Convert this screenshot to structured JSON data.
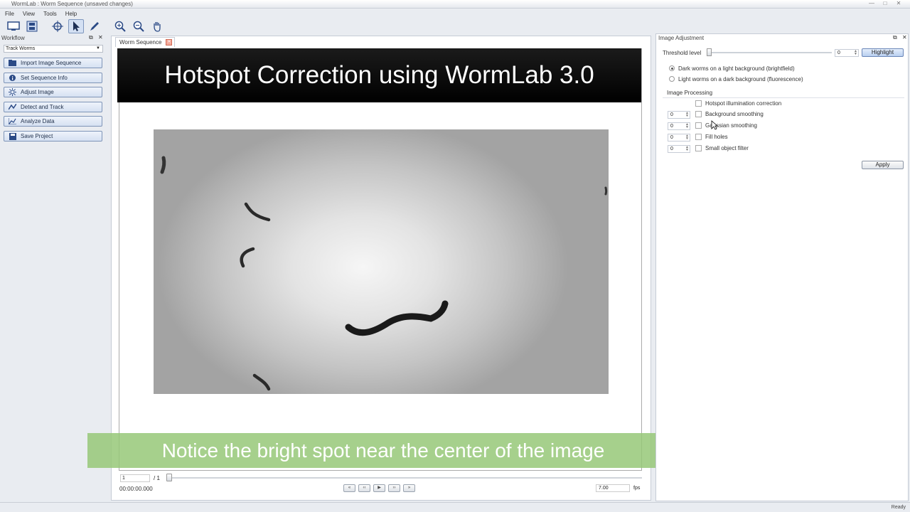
{
  "window": {
    "title": "WormLab : Worm Sequence (unsaved changes)"
  },
  "menu": [
    "File",
    "View",
    "Tools",
    "Help"
  ],
  "toolbar": {
    "icons": [
      "monitor-icon",
      "film-icon",
      "crosshair-icon",
      "pointer-icon",
      "pen-icon",
      "zoom-in-icon",
      "zoom-out-icon",
      "hand-icon"
    ],
    "active": "pointer-icon"
  },
  "workflow": {
    "title": "Workflow",
    "mode": "Track Worms",
    "steps": [
      {
        "label": "Import Image Sequence",
        "icon": "folder-icon"
      },
      {
        "label": "Set Sequence Info",
        "icon": "info-icon"
      },
      {
        "label": "Adjust Image",
        "icon": "sun-icon"
      },
      {
        "label": "Detect and Track",
        "icon": "track-icon"
      },
      {
        "label": "Analyze Data",
        "icon": "chart-icon"
      },
      {
        "label": "Save Project",
        "icon": "save-icon"
      }
    ]
  },
  "document": {
    "tab": "Worm Sequence",
    "banner": "Hotspot Correction using WormLab 3.0",
    "caption": "Notice the bright spot near the center of the image"
  },
  "playback": {
    "frame": "1",
    "total": "/ 1",
    "time": "00:00:00.000",
    "fps": "7.00",
    "fps_label": "fps",
    "buttons": [
      "«",
      "‹‹",
      "▶",
      "››",
      "»"
    ]
  },
  "adjust": {
    "title": "Image Adjustment",
    "threshold_label": "Threshold level",
    "threshold_value": "0",
    "highlight": "Highlight",
    "radio_dark": "Dark worms on a light background (brightfield)",
    "radio_light": "Light worms on a dark background (fluorescence)",
    "section": "Image Processing",
    "hotspot": "Hotspot illumination correction",
    "options": [
      {
        "value": "0",
        "label": "Background smoothing"
      },
      {
        "value": "0",
        "label": "Gaussian smoothing"
      },
      {
        "value": "0",
        "label": "Fill holes"
      },
      {
        "value": "0",
        "label": "Small object filter"
      }
    ],
    "apply": "Apply"
  },
  "status": "Ready"
}
